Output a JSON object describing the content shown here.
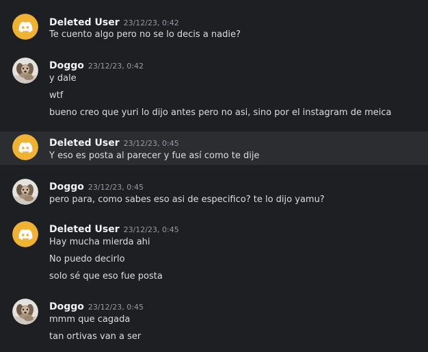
{
  "colors": {
    "background": "#1e1f22",
    "hover_row": "#2b2d31",
    "discord_avatar": "#f0b232",
    "username": "#f2f3f5",
    "timestamp": "#949ba4",
    "message": "#dbdee1"
  },
  "messages": [
    {
      "author": "Deleted User",
      "avatar_icon": "discord-logo-icon",
      "timestamp": "23/12/23, 0:42",
      "lines": [
        "Te cuento algo pero no se lo decis a nadie?"
      ]
    },
    {
      "author": "Doggo",
      "avatar_icon": "dog-photo-avatar",
      "timestamp": "23/12/23, 0:42",
      "lines": [
        "y dale",
        "wtf",
        "bueno creo que yuri lo dijo antes pero no asi, sino por el instagram de meica"
      ]
    },
    {
      "author": "Deleted User",
      "avatar_icon": "discord-logo-icon",
      "timestamp": "23/12/23, 0:45",
      "lines": [
        "Y eso es posta al parecer y fue así como te dije"
      ]
    },
    {
      "author": "Doggo",
      "avatar_icon": "dog-photo-avatar",
      "timestamp": "23/12/23, 0:45",
      "lines": [
        "pero para, como sabes eso asi de especifico? te lo dijo yamu?"
      ]
    },
    {
      "author": "Deleted User",
      "avatar_icon": "discord-logo-icon",
      "timestamp": "23/12/23, 0:45",
      "lines": [
        "Hay mucha mierda ahi",
        "No puedo decirlo",
        "solo sé que eso fue posta"
      ]
    },
    {
      "author": "Doggo",
      "avatar_icon": "dog-photo-avatar",
      "timestamp": "23/12/23, 0:45",
      "lines": [
        "mmm que cagada",
        "tan ortivas van a ser"
      ]
    }
  ]
}
